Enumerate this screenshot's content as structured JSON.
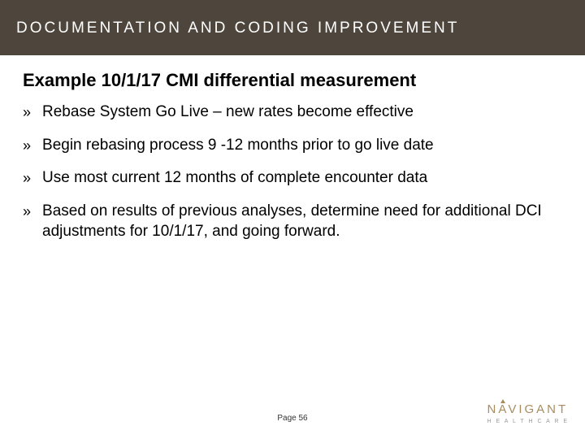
{
  "title": "DOCUMENTATION AND CODING IMPROVEMENT",
  "heading": "Example 10/1/17 CMI differential measurement",
  "bullets": [
    "Rebase System Go Live  – new rates become effective",
    "Begin rebasing process 9 -12 months prior to go live date",
    "Use most current 12 months of complete encounter data",
    "Based on results of previous analyses, determine need for additional DCI adjustments for 10/1/17, and going forward."
  ],
  "footer": {
    "page_label": "Page 56",
    "brand_name_pre": "N",
    "brand_name_mid": "A",
    "brand_name_post": "VIGANT",
    "brand_sub": "H E A L T H C A R E"
  }
}
